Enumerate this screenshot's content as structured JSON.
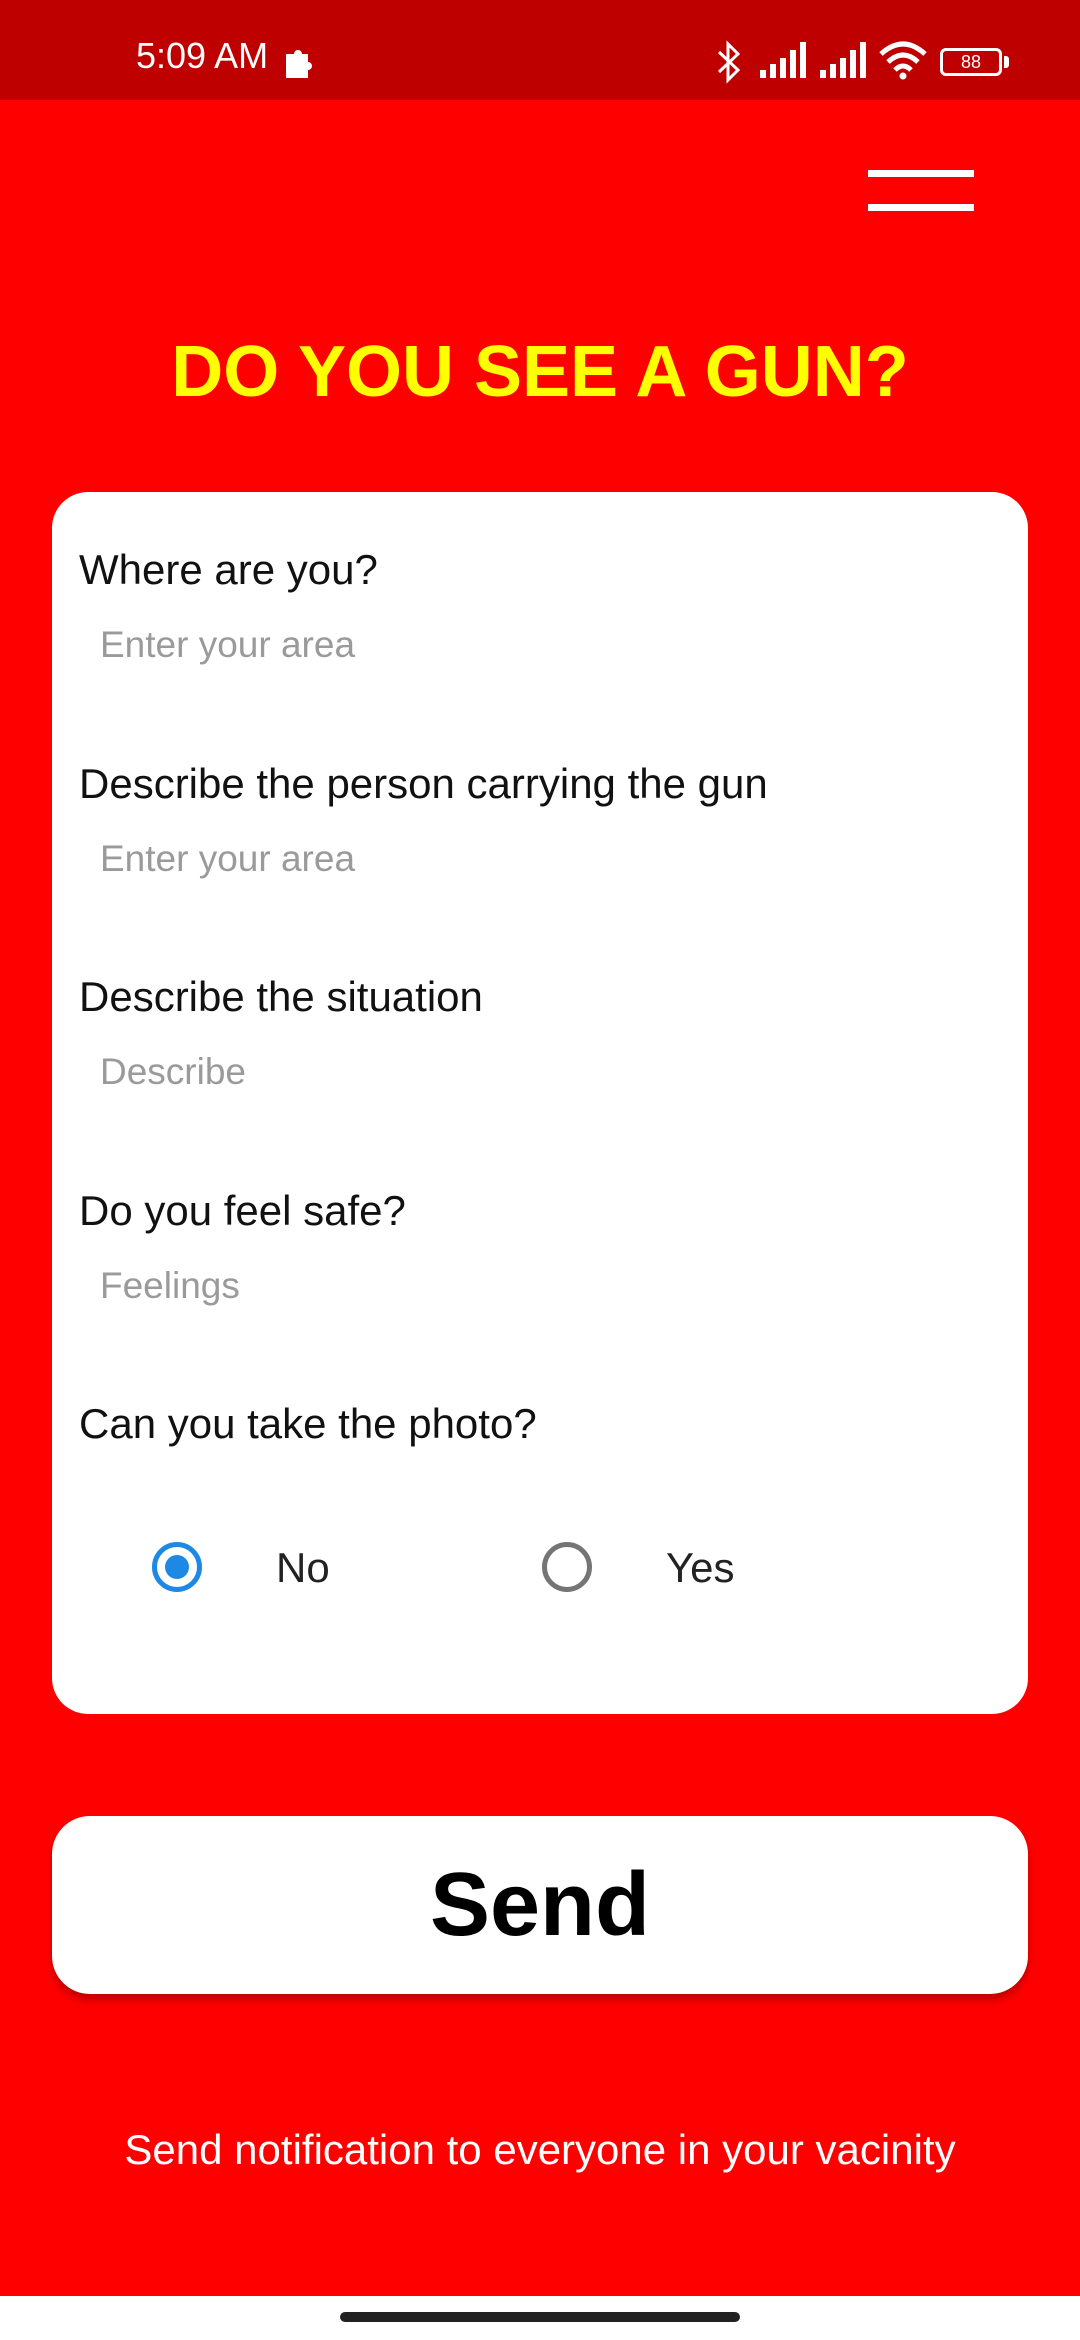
{
  "status_bar": {
    "time": "5:09 AM",
    "battery_level": "88",
    "icons": [
      "notification-icon",
      "bluetooth-icon",
      "signal-icon",
      "signal-icon",
      "wifi-icon",
      "battery-icon"
    ]
  },
  "header": {
    "menu_icon": "hamburger-menu-icon",
    "title": "DO YOU SEE A GUN?"
  },
  "form": {
    "fields": [
      {
        "label": "Where are you?",
        "placeholder": "Enter your area",
        "value": ""
      },
      {
        "label": "Describe the person carrying the gun",
        "placeholder": "Enter your area",
        "value": ""
      },
      {
        "label": "Describe the situation",
        "placeholder": "Describe",
        "value": ""
      },
      {
        "label": "Do you feel safe?",
        "placeholder": "Feelings",
        "value": ""
      }
    ],
    "photo_question": {
      "label": "Can you take the photo?",
      "options": [
        {
          "label": "No",
          "selected": true
        },
        {
          "label": "Yes",
          "selected": false
        }
      ]
    }
  },
  "send_button": {
    "label": "Send"
  },
  "footer": {
    "note": "Send notification to everyone in your vacinity"
  },
  "colors": {
    "background": "#ff0000",
    "status_bar": "#bf0000",
    "title": "#ffff00",
    "radio_selected": "#1e88e5"
  }
}
